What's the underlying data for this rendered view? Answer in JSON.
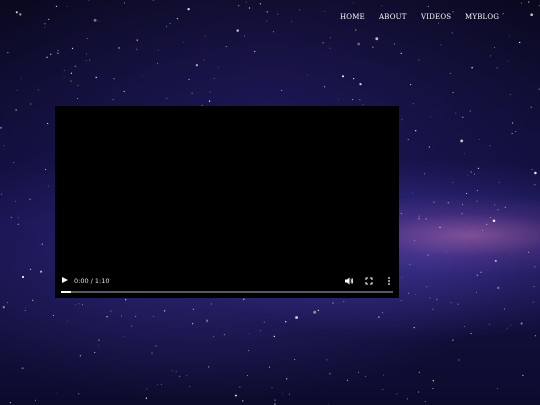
{
  "nav": {
    "items": [
      {
        "label": "HOME"
      },
      {
        "label": "ABOUT"
      },
      {
        "label": "VIDEOS"
      },
      {
        "label": "MYBLOG"
      }
    ]
  },
  "video_player": {
    "time_display": "0:00 / 1:10",
    "progress": 0.03,
    "icons": [
      "play-icon",
      "volume-icon",
      "fullscreen-icon",
      "more-options-icon"
    ]
  },
  "colors": {
    "background": "#15124a",
    "nav_text": "#ffffff",
    "player_bg": "#000000"
  }
}
